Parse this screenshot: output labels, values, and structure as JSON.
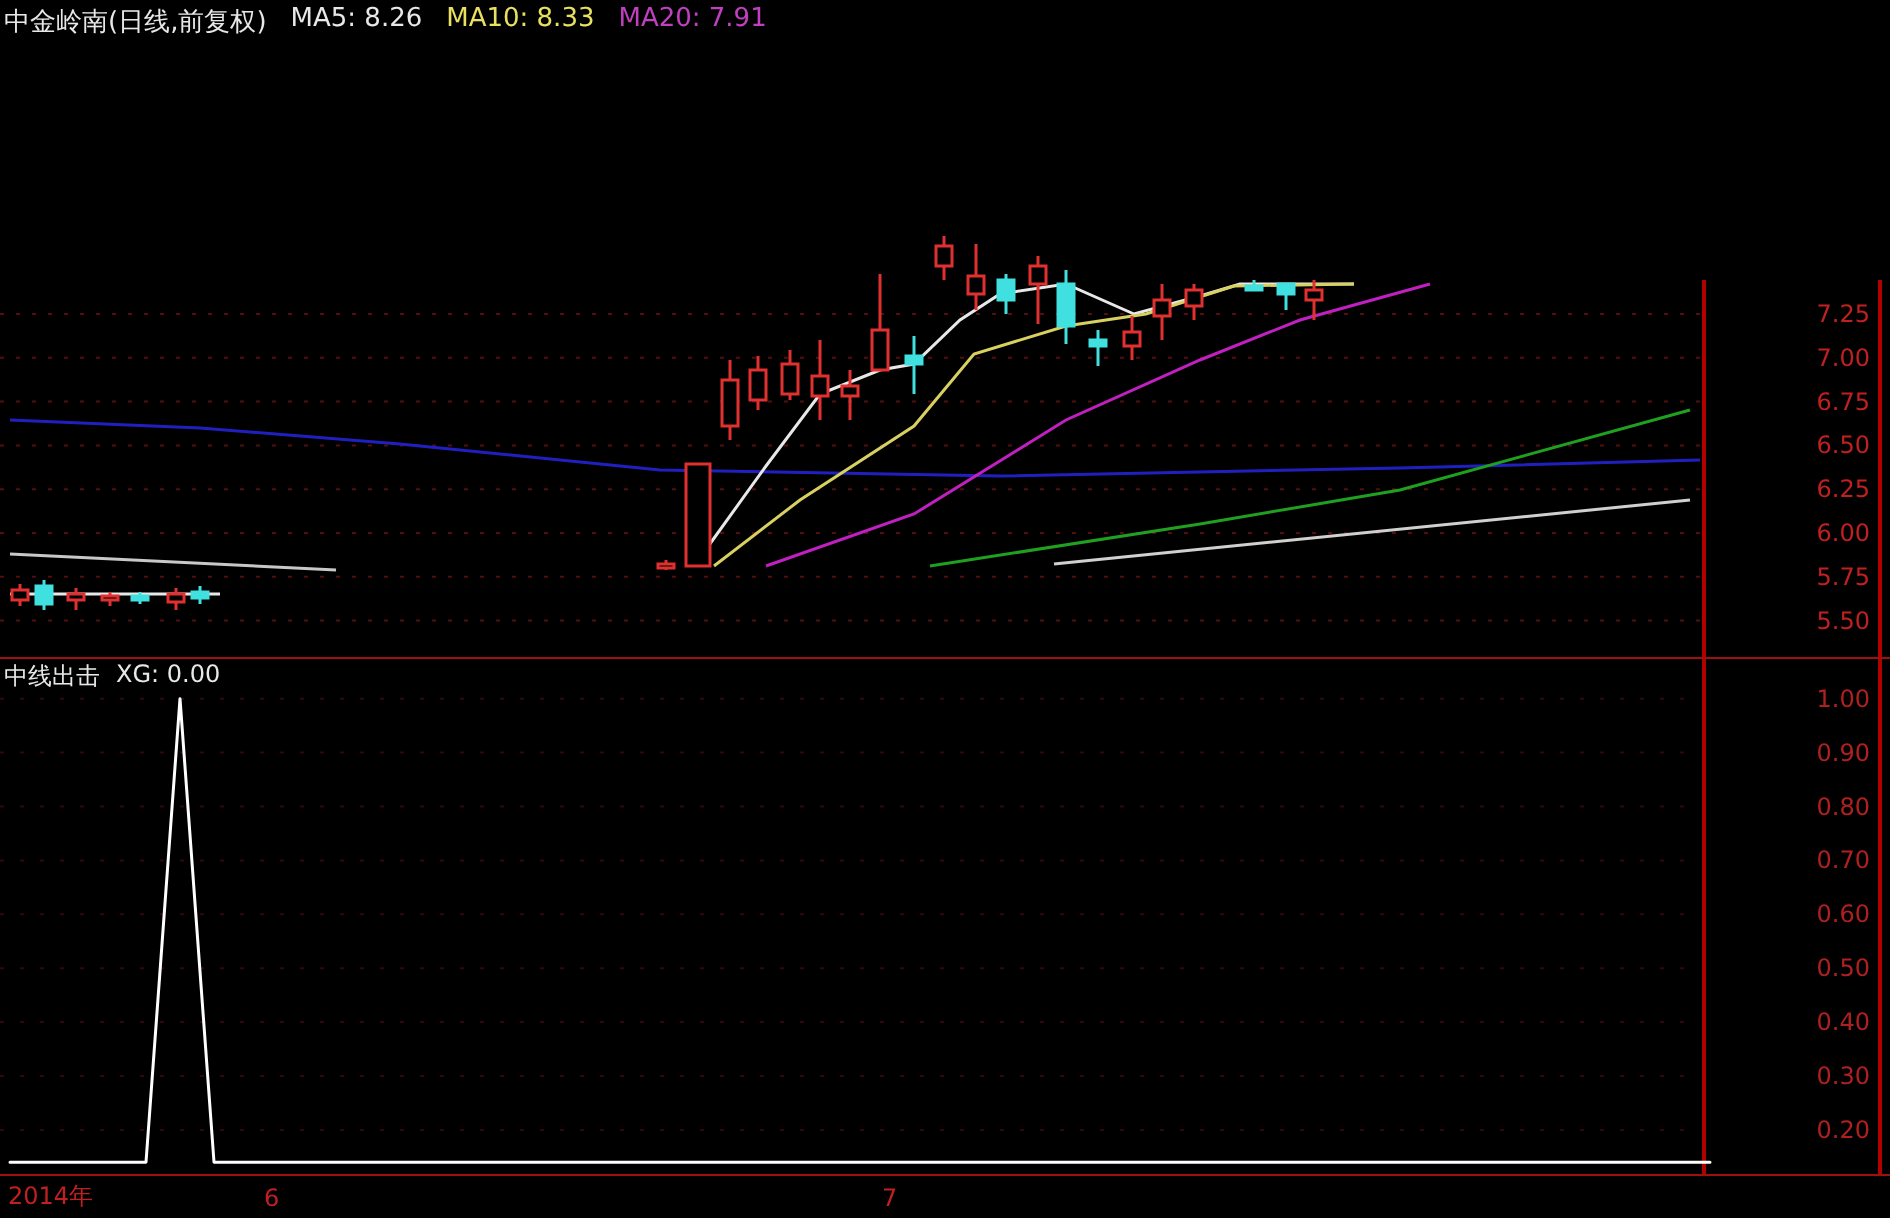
{
  "price_panel": {
    "title": "中金岭南(日线,前复权)",
    "indicators": [
      {
        "label": "MA5: 8.26",
        "color": "#e8e8e8"
      },
      {
        "label": "MA10: 8.33",
        "color": "#e8e060"
      },
      {
        "label": "MA20: 7.91",
        "color": "#c040c0"
      }
    ],
    "price_axis": [
      "7.25",
      "7.00",
      "6.75",
      "6.50",
      "6.25",
      "6.00",
      "5.75",
      "5.50"
    ]
  },
  "indicator_panel": {
    "title": "中线出击",
    "reading": "XG: 0.00",
    "chart_data": {
      "type": "line",
      "series": [
        {
          "color": "#ffffff",
          "values": [
            0.14,
            0.14,
            0.14,
            0.14,
            0.14,
            1,
            0.14,
            0.14,
            0.14,
            0.14,
            0.14,
            0.14,
            0.14,
            0.14,
            0.14,
            0.14,
            0.14,
            0.14,
            0.14,
            0.14,
            0.14,
            0.14,
            0.14,
            0.14,
            0.14,
            0.14,
            0.14,
            0.14,
            0.14,
            0.14,
            0.14,
            0.14,
            0.14,
            0.14,
            0.14,
            0.14,
            0.14,
            0.14,
            0.14,
            0.14,
            0.14,
            0.14,
            0.14,
            0.14,
            0.14,
            0.14,
            0.14,
            0.14,
            0.14,
            0.14,
            0.14
          ]
        }
      ],
      "ylim": [
        0.12,
        1.07
      ],
      "grid": true,
      "yticks": [
        {
          "value": 1,
          "label": "1.00"
        },
        {
          "value": 0.9,
          "label": "0.90"
        },
        {
          "value": 0.8,
          "label": "0.80"
        },
        {
          "value": 0.7,
          "label": "0.70"
        },
        {
          "value": 0.6,
          "label": "0.60"
        },
        {
          "value": 0.5,
          "label": "0.50"
        },
        {
          "value": 0.4,
          "label": "0.40"
        },
        {
          "value": 0.3,
          "label": "0.30"
        },
        {
          "value": 0.2,
          "label": "0.20"
        }
      ]
    }
  },
  "time_axis": [
    "2014年",
    "6",
    "7"
  ]
}
